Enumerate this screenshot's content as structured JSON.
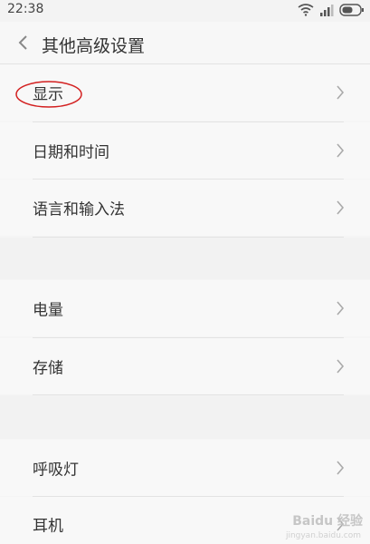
{
  "status_bar": {
    "time": "22:38"
  },
  "header": {
    "title": "其他高级设置"
  },
  "items": [
    {
      "label": "显示"
    },
    {
      "label": "日期和时间"
    },
    {
      "label": "语言和输入法"
    },
    {
      "label": "电量"
    },
    {
      "label": "存储"
    },
    {
      "label": "呼吸灯"
    },
    {
      "label": "耳机"
    }
  ],
  "watermark": {
    "text": "Baidu 经验",
    "url": "jingyan.baidu.com"
  },
  "colors": {
    "highlight_circle": "#d32020",
    "background": "#f5f5f5"
  },
  "icons": {
    "back": "chevron-left-icon",
    "row_arrow": "chevron-right-icon",
    "wifi": "wifi-icon",
    "signal": "signal-icon",
    "battery": "battery-icon"
  }
}
